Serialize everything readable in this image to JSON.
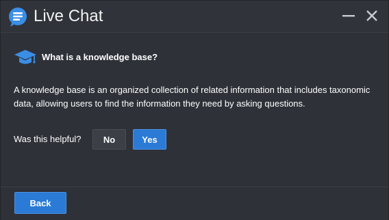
{
  "window": {
    "title": "Live Chat",
    "icons": {
      "app": "chat-bubble-icon",
      "minimize": "minimize-icon",
      "close": "close-icon"
    },
    "colors": {
      "background": "#2e3138",
      "accent": "#2a7ad6",
      "icon_blue": "#3a8ee6"
    }
  },
  "article": {
    "icon": "graduation-cap-icon",
    "question": "What is a knowledge base?",
    "answer": "A knowledge base is an organized collection of related information that includes taxonomic data, allowing users to find the information they need by asking questions."
  },
  "feedback": {
    "label": "Was this helpful?",
    "no_label": "No",
    "yes_label": "Yes"
  },
  "footer": {
    "back_label": "Back"
  }
}
